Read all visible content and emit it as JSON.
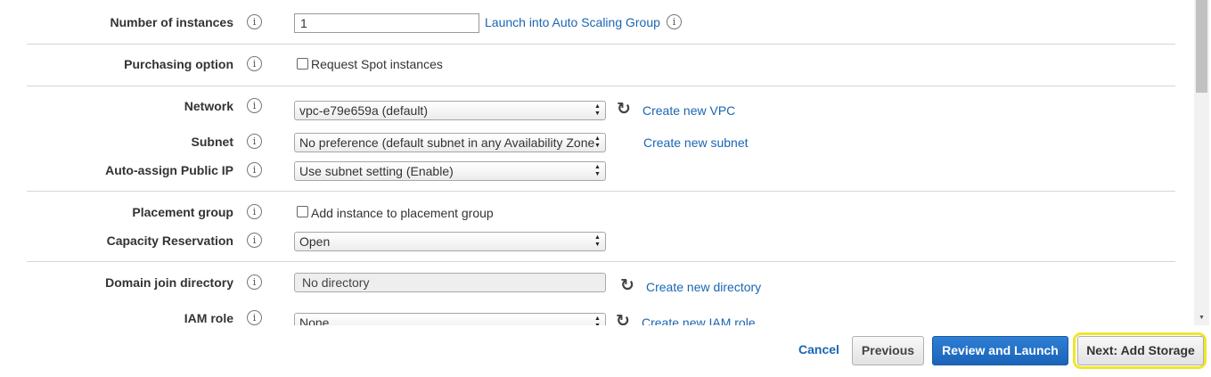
{
  "fields": {
    "instances": {
      "label": "Number of instances",
      "value": "1",
      "link": "Launch into Auto Scaling Group"
    },
    "purchasing": {
      "label": "Purchasing option",
      "checkbox_label": "Request Spot instances",
      "checked": false
    },
    "network": {
      "label": "Network",
      "value": "vpc-e79e659a (default)",
      "link": "Create new VPC"
    },
    "subnet": {
      "label": "Subnet",
      "value": "No preference (default subnet in any Availability Zone",
      "link": "Create new subnet"
    },
    "public_ip": {
      "label": "Auto-assign Public IP",
      "value": "Use subnet setting (Enable)"
    },
    "placement": {
      "label": "Placement group",
      "checkbox_label": "Add instance to placement group",
      "checked": false
    },
    "capacity": {
      "label": "Capacity Reservation",
      "value": "Open"
    },
    "domain": {
      "label": "Domain join directory",
      "value": "No directory",
      "link": "Create new directory"
    },
    "iam": {
      "label": "IAM role",
      "value": "None",
      "link": "Create new IAM role"
    }
  },
  "info_icon_glyph": "i",
  "footer": {
    "cancel": "Cancel",
    "previous": "Previous",
    "review": "Review and Launch",
    "next": "Next: Add Storage"
  },
  "colors": {
    "link": "#1a66b3",
    "primary_button": "#1a64b9",
    "highlight": "#f0e62a"
  }
}
